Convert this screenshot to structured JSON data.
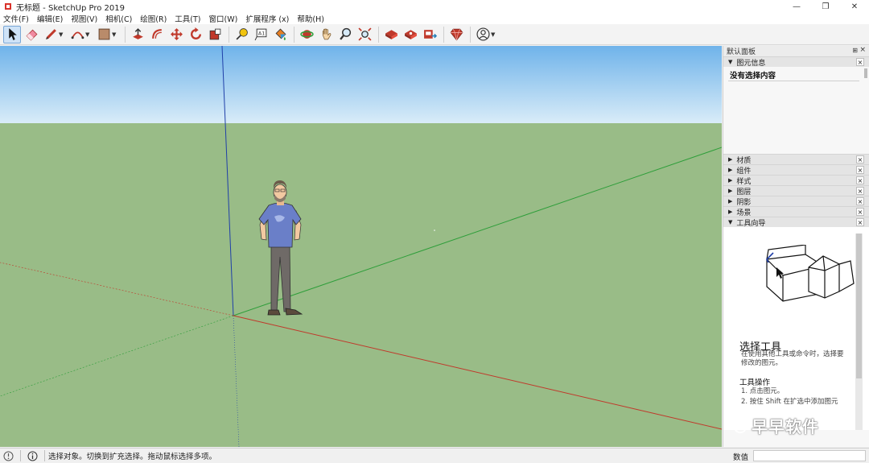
{
  "window": {
    "title": "无标题 - SketchUp Pro 2019",
    "controls": [
      "—",
      "❐",
      "✕"
    ]
  },
  "menu": [
    "文件(F)",
    "编辑(E)",
    "视图(V)",
    "相机(C)",
    "绘图(R)",
    "工具(T)",
    "窗口(W)",
    "扩展程序 (x)",
    "帮助(H)"
  ],
  "toolbar": {
    "tools": [
      {
        "name": "select-tool",
        "icon": "arrow-cursor-icon"
      },
      {
        "name": "eraser-tool",
        "icon": "eraser-icon"
      },
      {
        "name": "line-tool",
        "icon": "pencil-icon"
      },
      {
        "name": "arc-tool",
        "icon": "arc-icon"
      },
      {
        "name": "shape-tool",
        "icon": "rectangle-icon"
      },
      {
        "name": "push-pull-tool",
        "icon": "push-pull-icon"
      },
      {
        "name": "offset-tool",
        "icon": "offset-icon"
      },
      {
        "name": "move-tool",
        "icon": "move-icon"
      },
      {
        "name": "rotate-tool",
        "icon": "rotate-icon"
      },
      {
        "name": "scale-tool",
        "icon": "scale-icon"
      },
      {
        "name": "tape-measure-tool",
        "icon": "tape-measure-icon"
      },
      {
        "name": "text-tool",
        "icon": "text-icon"
      },
      {
        "name": "paint-bucket-tool",
        "icon": "paint-bucket-icon"
      },
      {
        "name": "orbit-tool",
        "icon": "orbit-icon"
      },
      {
        "name": "pan-tool",
        "icon": "hand-icon"
      },
      {
        "name": "zoom-tool",
        "icon": "magnifier-icon"
      },
      {
        "name": "zoom-extents-tool",
        "icon": "zoom-extents-icon"
      },
      {
        "name": "3d-warehouse-tool",
        "icon": "warehouse-icon"
      },
      {
        "name": "extension-warehouse-tool",
        "icon": "extension-warehouse-icon"
      },
      {
        "name": "send-to-layout-tool",
        "icon": "layout-icon"
      },
      {
        "name": "extension-manager-tool",
        "icon": "ruby-icon"
      },
      {
        "name": "account-tool",
        "icon": "user-icon"
      }
    ]
  },
  "panel": {
    "title": "默认面板",
    "pin": "⊞",
    "close": "×",
    "entity_info": {
      "label": "图元信息",
      "content": "没有选择内容"
    },
    "trays": [
      "材质",
      "组件",
      "样式",
      "图层",
      "阴影",
      "场景"
    ],
    "instructor": {
      "label": "工具向导",
      "title": "选择工具",
      "description": "在使用其他工具或命令时，选择要修改的图元。",
      "subtitle": "工具操作",
      "step1": "1. 点击图元。",
      "step2": "2. 按住 Shift 在扩选中添加图元"
    },
    "close_glyph": "×",
    "arrow_collapsed": "▶",
    "arrow_expanded": "▼"
  },
  "watermark": {
    "text": "早早软件"
  },
  "status": {
    "message": "选择对象。切换到扩充选择。拖动鼠标选择多项。",
    "measurements_label": "数值"
  },
  "colors": {
    "sky_top": "#6fb3ea",
    "sky_bottom": "#d9ecf8",
    "ground": "#99bc87",
    "axis_red": "#c0392b",
    "axis_green": "#2e9e3a",
    "axis_blue": "#1f3fa8"
  }
}
